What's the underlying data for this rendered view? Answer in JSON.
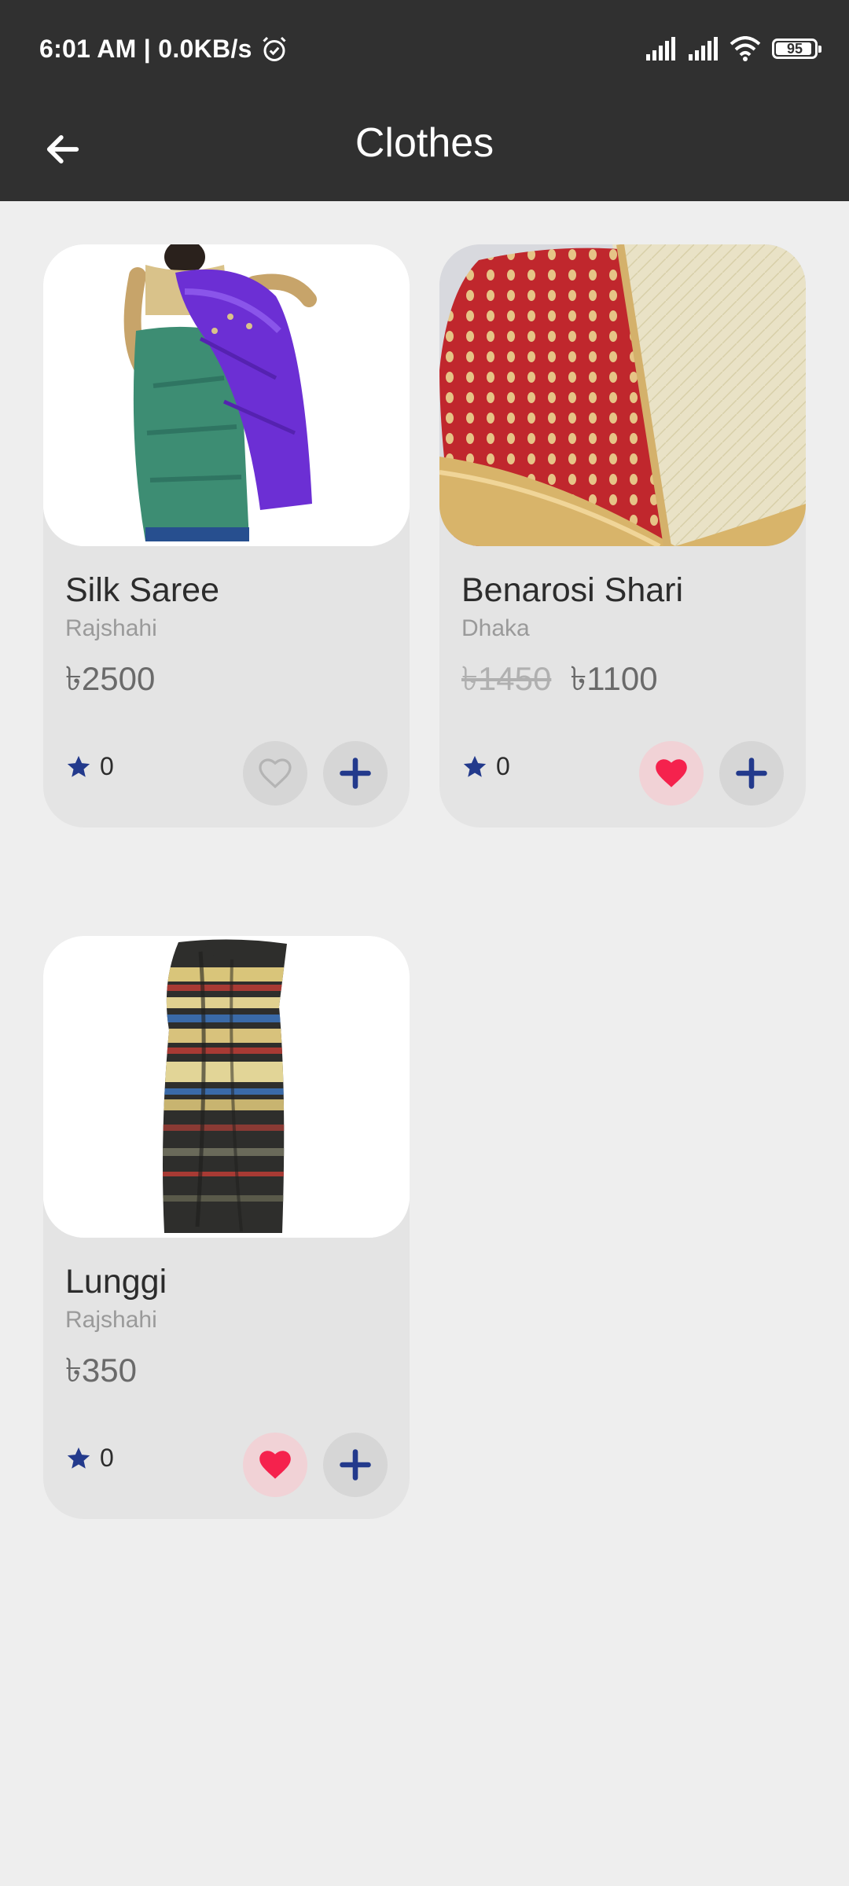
{
  "status_bar": {
    "time_speed": "6:01 AM | 0.0KB/s",
    "battery": "95",
    "icons": [
      "alarm-icon",
      "signal-icon",
      "signal-icon",
      "wifi-icon",
      "battery-icon"
    ]
  },
  "app_bar": {
    "title": "Clothes",
    "back_icon": "arrow-left-icon"
  },
  "colors": {
    "bar_bg": "#303030",
    "accent_blue": "#233a8c",
    "heart_red": "#f5224d"
  },
  "products": [
    {
      "name": "Silk Saree",
      "location": "Rajshahi",
      "price": "৳2500",
      "old_price": "",
      "rating": "0",
      "favorite": false
    },
    {
      "name": "Benarosi Shari",
      "location": "Dhaka",
      "price": "৳1100",
      "old_price": "৳1450",
      "rating": "0",
      "favorite": true
    },
    {
      "name": "Lunggi",
      "location": "Rajshahi",
      "price": "৳350",
      "old_price": "",
      "rating": "0",
      "favorite": true
    }
  ]
}
